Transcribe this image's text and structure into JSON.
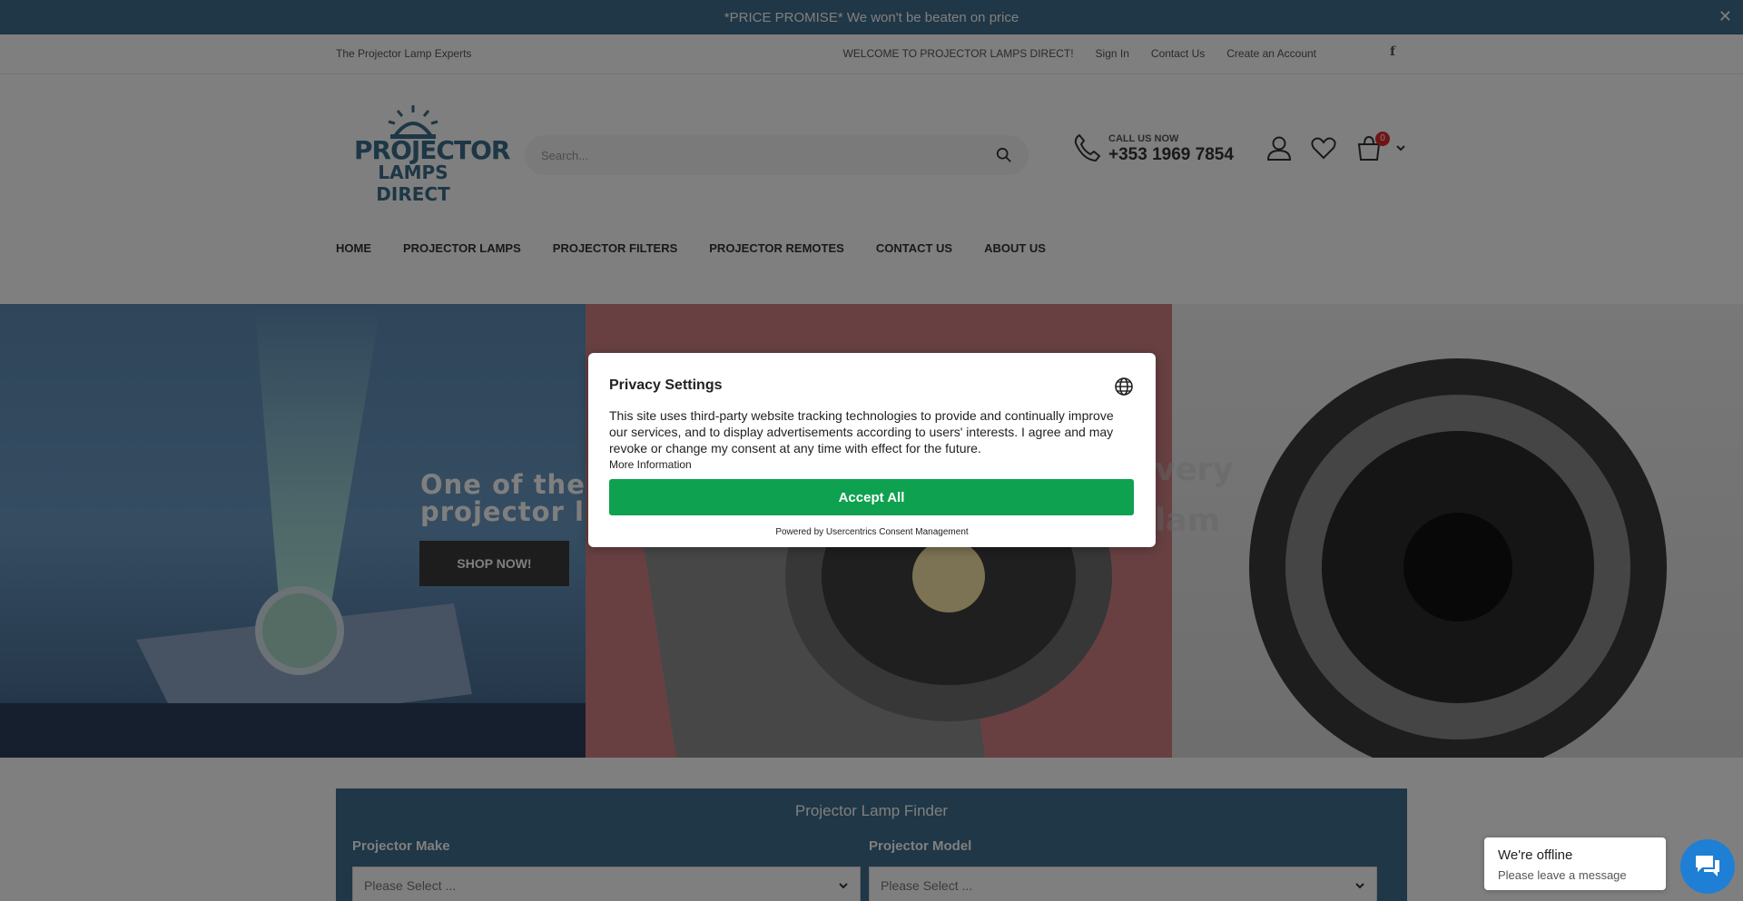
{
  "promo": {
    "text": "*PRICE PROMISE* We won't be beaten on price",
    "close": "✕"
  },
  "topbar": {
    "tagline": "The Projector Lamp Experts",
    "links": [
      "WELCOME TO PROJECTOR LAMPS DIRECT!",
      "Sign In",
      "Contact Us",
      "Create an Account"
    ],
    "facebook": "f"
  },
  "header": {
    "logo_line1": "PROJECTOR",
    "logo_line2": "LAMPS DIRECT",
    "search_placeholder": "Search...",
    "call_label": "CALL US NOW",
    "call_number": "+353 1969 7854",
    "cart_count": "0"
  },
  "nav": [
    "HOME",
    "PROJECTOR LAMPS",
    "PROJECTOR FILTERS",
    "PROJECTOR REMOTES",
    "CONTACT US",
    "ABOUT US"
  ],
  "hero": {
    "title_line1": "One of the",
    "title_line2": "projector l",
    "button": "SHOP NOW!",
    "panel3_line1": "ivery",
    "panel3_line2": "llam"
  },
  "finder": {
    "title": "Projector Lamp Finder",
    "make_label": "Projector Make",
    "model_label": "Projector Model",
    "make_placeholder": "Please Select ...",
    "model_placeholder": "Please Select ..."
  },
  "modal": {
    "title": "Privacy Settings",
    "body": "This site uses third-party website tracking technologies to provide and continually improve our services, and to display advertisements according to users' interests. I agree and may revoke or change my consent at any time with effect for the future.",
    "more_info": "More Information",
    "accept": "Accept All",
    "powered": "Powered by Usercentrics Consent Management"
  },
  "chat": {
    "title": "We're offline",
    "subtitle": "Please leave a message"
  },
  "colors": {
    "brand": "#3e6f8c",
    "accept": "#0ea150",
    "chat": "#1f7fd4",
    "badge": "#e02b2b"
  }
}
